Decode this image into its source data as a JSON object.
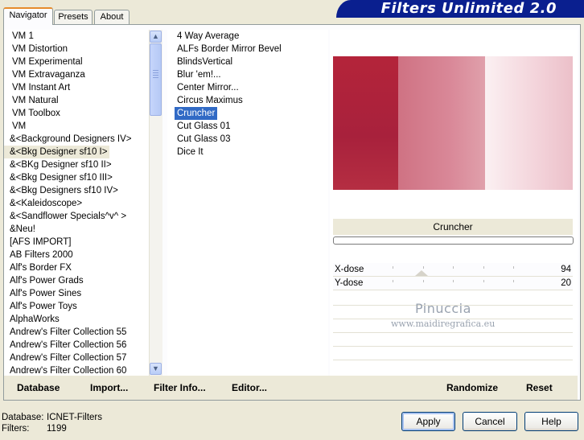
{
  "window": {
    "title": "Filters Unlimited 2.0"
  },
  "tabs": [
    {
      "label": "Navigator",
      "active": true
    },
    {
      "label": "Presets",
      "active": false
    },
    {
      "label": "About",
      "active": false
    }
  ],
  "categories": {
    "items": [
      "VM 1",
      "VM Distortion",
      "VM Experimental",
      "VM Extravaganza",
      "VM Instant Art",
      "VM Natural",
      "VM Toolbox",
      "VM",
      "&<Background Designers IV>",
      "&<Bkg Designer sf10 I>",
      "&<BKg Designer sf10 II>",
      "&<Bkg Designer sf10 III>",
      "&<Bkg Designers sf10 IV>",
      "&<Kaleidoscope>",
      "&<Sandflower Specials^v^ >",
      "&Neu!",
      "[AFS IMPORT]",
      "AB Filters 2000",
      "Alf's Border FX",
      "Alf's Power Grads",
      "Alf's Power Sines",
      "Alf's Power Toys",
      "AlphaWorks",
      "Andrew's Filter Collection 55",
      "Andrew's Filter Collection 56",
      "Andrew's Filter Collection 57",
      "Andrew's Filter Collection 60"
    ],
    "selected_index": 9
  },
  "filters": {
    "items": [
      "4 Way Average",
      "ALFs Border Mirror Bevel",
      "BlindsVertical",
      "Blur 'em!...",
      "Center Mirror...",
      "Circus Maximus",
      "Cruncher",
      "Cut Glass  01",
      "Cut Glass 03",
      "Dice It"
    ],
    "selected_index": 6
  },
  "bottom_buttons": {
    "database": "Database",
    "import": "Import...",
    "filter_info": "Filter Info...",
    "editor": "Editor...",
    "randomize": "Randomize",
    "reset": "Reset"
  },
  "preview": {
    "filter_name": "Cruncher",
    "colors": {
      "dark": "#b0233a",
      "mid": "#d6808f",
      "light": "#f5dde2"
    }
  },
  "controls": [
    {
      "name": "X-dose",
      "value": "94",
      "level": 94
    },
    {
      "name": "Y-dose",
      "value": "20",
      "level": 20
    }
  ],
  "watermark": {
    "line1": "Pinuccia",
    "line2": "www.maidiregrafica.eu"
  },
  "footer": {
    "database_label": "Database:",
    "database_value": "ICNET-Filters",
    "filters_label": "Filters:",
    "filters_value": "1199",
    "apply": "Apply",
    "cancel": "Cancel",
    "help": "Help"
  },
  "icons": {
    "scroll_up": "chevron-up-icon",
    "scroll_down": "chevron-down-icon"
  }
}
